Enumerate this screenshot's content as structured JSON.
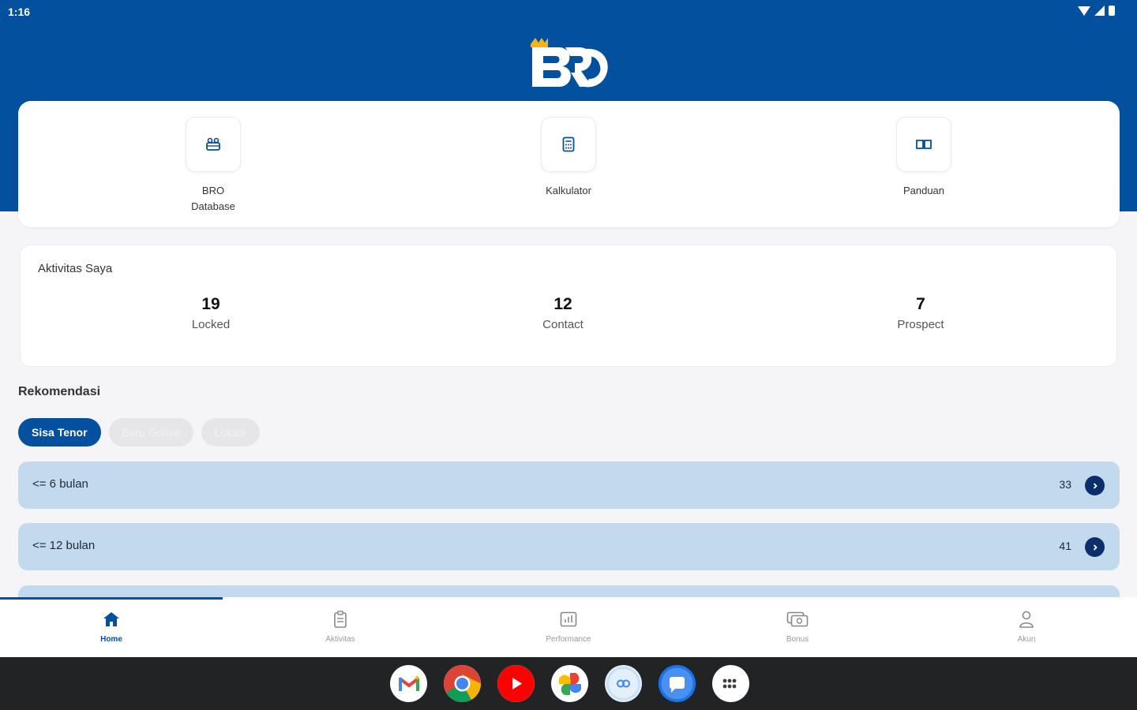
{
  "status_bar": {
    "time": "1:16"
  },
  "colors": {
    "brand": "#03509e",
    "rec_row_bg": "#c3d9ee",
    "arrow": "#0b2f6b",
    "taskbar": "#222325"
  },
  "header": {
    "logo_text": "BRO"
  },
  "quick_menu": [
    {
      "label": "BRO\nDatabase",
      "icon": "database-icon"
    },
    {
      "label": "Kalkulator",
      "icon": "calculator-icon"
    },
    {
      "label": "Panduan",
      "icon": "book-icon"
    }
  ],
  "activity": {
    "title": "Aktivitas Saya",
    "stats": [
      {
        "value": "19",
        "label": "Locked"
      },
      {
        "value": "12",
        "label": "Contact"
      },
      {
        "value": "7",
        "label": "Prospect"
      }
    ]
  },
  "recommendations": {
    "title": "Rekomendasi",
    "filters": [
      {
        "label": "Sisa Tenor",
        "active": true
      },
      {
        "label": "Baru Golive",
        "active": false
      },
      {
        "label": "Lokasi",
        "active": false
      }
    ],
    "rows": [
      {
        "label": "<= 6 bulan",
        "count": "33"
      },
      {
        "label": "<= 12 bulan",
        "count": "41"
      }
    ]
  },
  "bottom_nav": [
    {
      "label": "Home",
      "icon": "home-icon",
      "active": true
    },
    {
      "label": "Aktivitas",
      "icon": "clipboard-icon",
      "active": false
    },
    {
      "label": "Performance",
      "icon": "chart-icon",
      "active": false
    },
    {
      "label": "Bonus",
      "icon": "money-icon",
      "active": false
    },
    {
      "label": "Akun",
      "icon": "person-icon",
      "active": false
    }
  ],
  "dock_apps": [
    "gmail-icon",
    "chrome-icon",
    "youtube-icon",
    "photos-icon",
    "meet-icon",
    "messages-icon",
    "app-drawer-icon"
  ]
}
